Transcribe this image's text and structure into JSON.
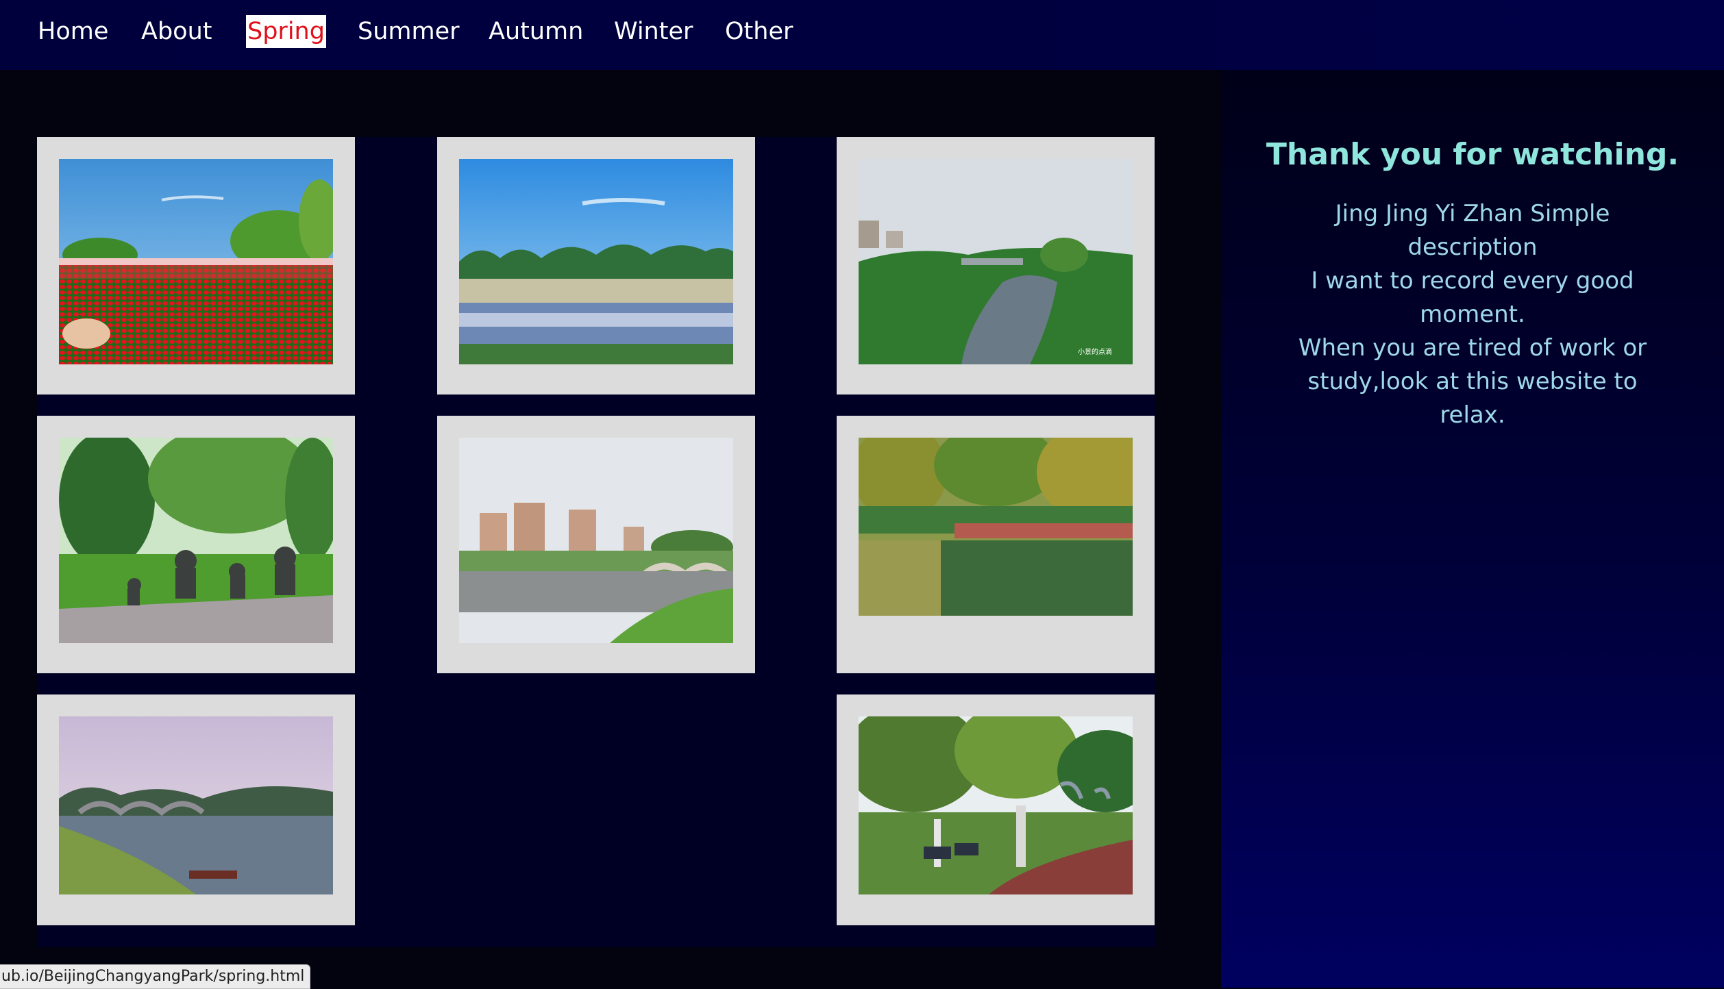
{
  "nav": {
    "items": [
      {
        "label": "Home"
      },
      {
        "label": "About"
      },
      {
        "label": "Spring"
      },
      {
        "label": "Summer"
      },
      {
        "label": "Autumn"
      },
      {
        "label": "Winter"
      },
      {
        "label": "Other"
      }
    ],
    "active_item": "Spring"
  },
  "gallery": {
    "photos": [
      {
        "subject": "red tulip field"
      },
      {
        "subject": "lake with reeds under blue sky"
      },
      {
        "subject": "river with lotus leaves and bridge",
        "watermark": "小景的点滴"
      },
      {
        "subject": "bronze animal sculptures in park"
      },
      {
        "subject": "river with apartment buildings and bridge"
      },
      {
        "subject": "lotus pond with wooden boardwalk"
      },
      {
        "subject": "bridge and pond at dusk with boat"
      },
      {
        "subject": "park path with benches and willow trees"
      }
    ]
  },
  "sidebar": {
    "title": "Thank you for watching.",
    "lines": [
      "Jing Jing Yi Zhan Simple",
      "description",
      "I want to record every good",
      "moment.",
      "When you are tired of work or",
      "study,look at this website to relax."
    ]
  },
  "status_url": "ub.io/BeijingChangyangPark/spring.html",
  "colors": {
    "nav_bg": "#00003f",
    "active_text": "#e0101a",
    "sidebar_title": "#8fe6dd",
    "sidebar_text": "#9fd8e8",
    "card_frame": "#dcdcdc"
  }
}
